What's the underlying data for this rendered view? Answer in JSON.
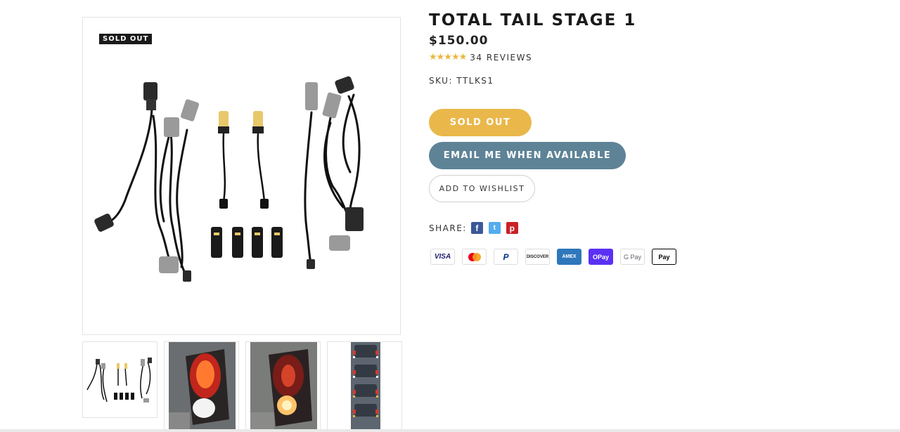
{
  "gallery": {
    "badge": "SOLD OUT",
    "main_alt": "Total Tail Stage 1 wiring harnesses and LED bulbs",
    "thumbs": [
      "kit-contents",
      "tail-light-red",
      "tail-light-amber",
      "truck-rear-sequence"
    ]
  },
  "product": {
    "title": "TOTAL TAIL STAGE 1",
    "price": "$150.00",
    "stars": "★★★★★",
    "reviews": "34 REVIEWS",
    "sku": "SKU: TTLKS1"
  },
  "actions": {
    "sold_out": "SOLD OUT",
    "email": "EMAIL ME WHEN AVAILABLE",
    "wishlist": "ADD TO WISHLIST"
  },
  "share": {
    "label": "SHARE:",
    "networks": [
      {
        "name": "facebook",
        "glyph": "f"
      },
      {
        "name": "twitter",
        "glyph": "t"
      },
      {
        "name": "pinterest",
        "glyph": "p"
      }
    ]
  },
  "payments": [
    {
      "name": "visa",
      "label": "VISA"
    },
    {
      "name": "mastercard",
      "label": ""
    },
    {
      "name": "paypal",
      "label": "P"
    },
    {
      "name": "discover",
      "label": "DISCOVER"
    },
    {
      "name": "amex",
      "label": "AMEX"
    },
    {
      "name": "shop-pay",
      "label": "OPay"
    },
    {
      "name": "google-pay",
      "label": "G Pay"
    },
    {
      "name": "apple-pay",
      "label": " Pay"
    }
  ],
  "colors": {
    "accent_gold": "#eab84a",
    "accent_blue": "#5e8397",
    "star": "#e9b840"
  }
}
